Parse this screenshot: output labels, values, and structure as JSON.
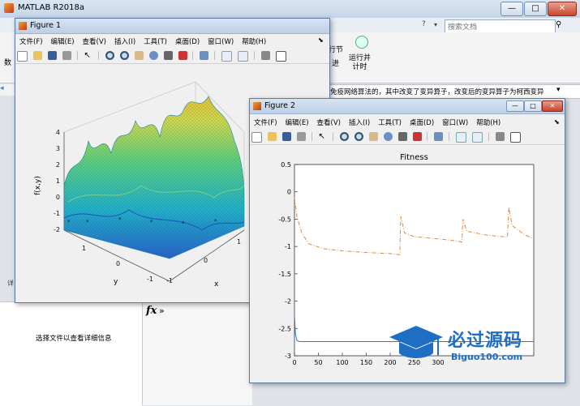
{
  "app": {
    "title": "MATLAB R2018a",
    "search_placeholder": "搜索文档",
    "window_controls": {
      "minimize": "—",
      "maximize": "□",
      "close": "✕"
    },
    "ribbon_items": [
      "行节",
      "运行并\n计时",
      "进"
    ],
    "command_text": "免疫网络算法的，其中改变了变异算子，改变后的变异算子为柯西变异",
    "details_text": "选择文件以查看详细信息",
    "fx_label": "fx",
    "chevron": "»",
    "left_tab_fragment": "详",
    "left_char": "数"
  },
  "figure1": {
    "title": "Figure 1",
    "menu": [
      "文件(F)",
      "编辑(E)",
      "查看(V)",
      "插入(I)",
      "工具(T)",
      "桌面(D)",
      "窗口(W)",
      "帮助(H)"
    ],
    "zlabel": "f(x,y)",
    "ylabel": "y",
    "xlabel": "x",
    "z_ticks": [
      "4",
      "3",
      "2",
      "1",
      "0",
      "-1",
      "-2"
    ],
    "y_ticks": [
      "1",
      "0",
      "-1"
    ],
    "x_ticks": [
      "-1",
      "0",
      "1"
    ]
  },
  "figure2": {
    "title": "Figure 2",
    "menu": [
      "文件(F)",
      "编辑(E)",
      "查看(V)",
      "插入(I)",
      "工具(T)",
      "桌面(D)",
      "窗口(W)",
      "帮助(H)"
    ]
  },
  "watermark": {
    "brand": "必过源码",
    "url": "Biguo100.com"
  },
  "chart_data": {
    "type": "line",
    "title": "Fitness",
    "xlabel": "",
    "ylabel": "",
    "xlim": [
      0,
      500
    ],
    "ylim": [
      -3,
      0.5
    ],
    "x_ticks": [
      0,
      50,
      100,
      150,
      200,
      250,
      300
    ],
    "y_ticks": [
      0.5,
      0,
      -0.5,
      -1,
      -1.5,
      -2,
      -2.5,
      -3
    ],
    "grid": false,
    "series": [
      {
        "color": "#d98c3f",
        "style": "dash-dot",
        "x": [
          0,
          5,
          15,
          30,
          60,
          100,
          150,
          200,
          220,
          222,
          230,
          250,
          300,
          340,
          350,
          352,
          360,
          400,
          445,
          448,
          455,
          480,
          500
        ],
        "y": [
          -0.1,
          -0.45,
          -0.75,
          -0.95,
          -1.04,
          -1.08,
          -1.11,
          -1.13,
          -1.15,
          -0.45,
          -0.75,
          -0.82,
          -0.86,
          -0.9,
          -0.92,
          -0.5,
          -0.72,
          -0.79,
          -0.83,
          -0.28,
          -0.62,
          -0.78,
          -0.86
        ]
      },
      {
        "color": "#2e7cc4",
        "style": "solid",
        "x": [
          0,
          2,
          5,
          10,
          30,
          100,
          200,
          300,
          400,
          500
        ],
        "y": [
          -2.25,
          -2.6,
          -2.72,
          -2.74,
          -2.74,
          -2.74,
          -2.74,
          -2.74,
          -2.74,
          -2.74
        ]
      }
    ]
  }
}
